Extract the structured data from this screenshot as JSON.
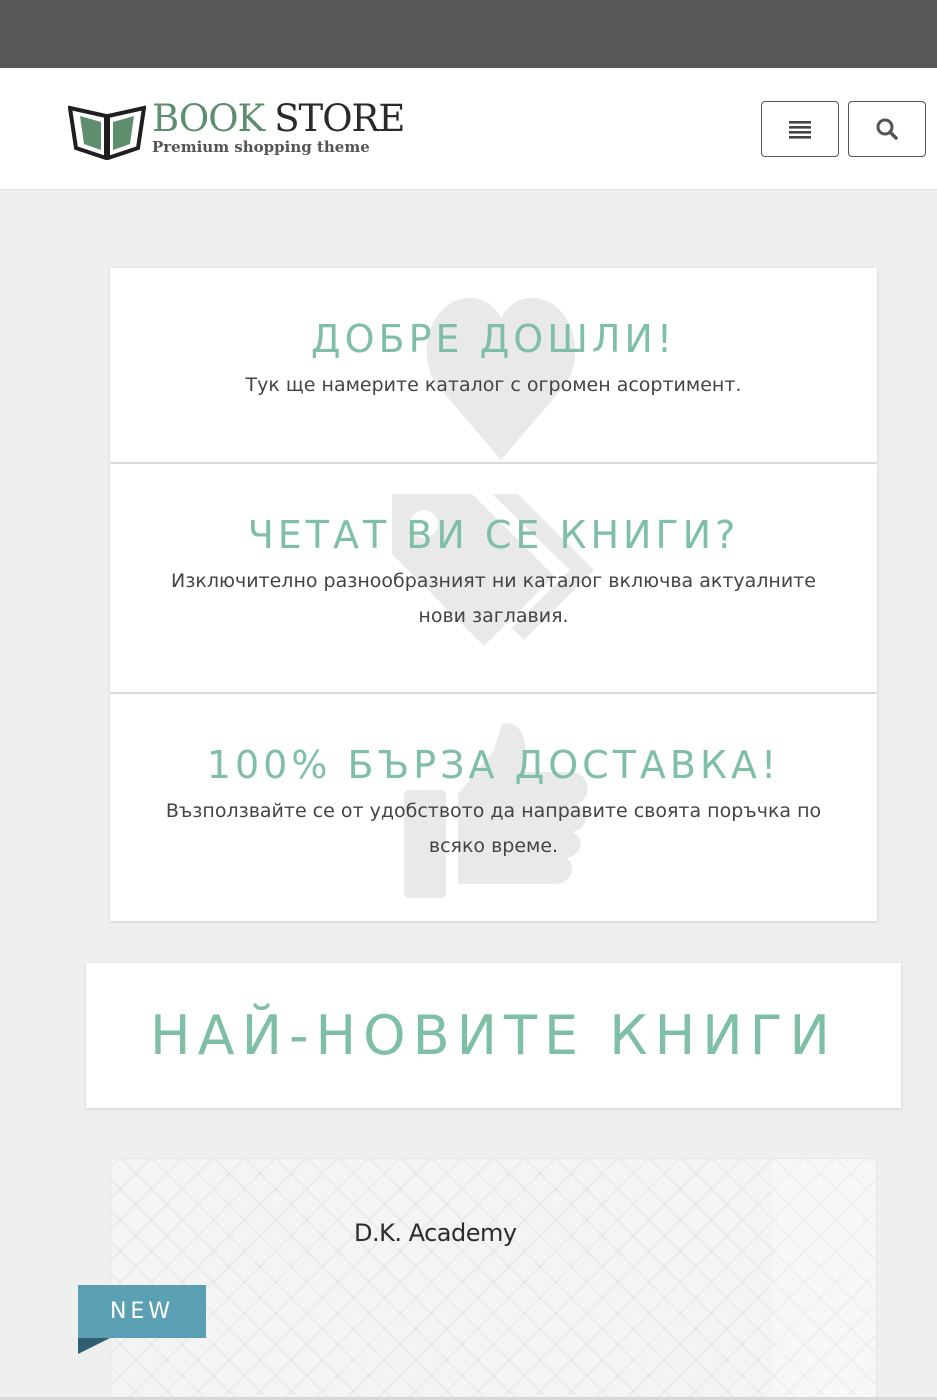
{
  "brand": {
    "name_part1": "BOOK",
    "name_part2": "STORE",
    "tagline": "Premium shopping theme"
  },
  "header": {
    "menu_icon": "hamburger-menu-icon",
    "search_icon": "search-icon"
  },
  "features": [
    {
      "title": "ДОБРЕ ДОШЛИ!",
      "text": "Тук ще намерите каталог с огромен асортимент.",
      "icon": "heart-icon"
    },
    {
      "title": "ЧЕТАТ ВИ СЕ КНИГИ?",
      "text": "Изключително разнообразният ни каталог включва актуалните нови заглавия.",
      "icon": "tags-icon"
    },
    {
      "title": "100% БЪРЗА ДОСТАВКА!",
      "text": "Възползвайте се от удобството да направите своята поръчка по всяко време.",
      "icon": "thumbs-up-icon"
    }
  ],
  "latest_section": {
    "title": "НАЙ-НОВИТЕ КНИГИ"
  },
  "product": {
    "brand_text": "D.K. Academy",
    "badge": "NEW"
  },
  "colors": {
    "accent": "#7fbfa6",
    "topbar": "#575757",
    "badge": "#5a9fb3",
    "page_bg": "#efefef"
  }
}
